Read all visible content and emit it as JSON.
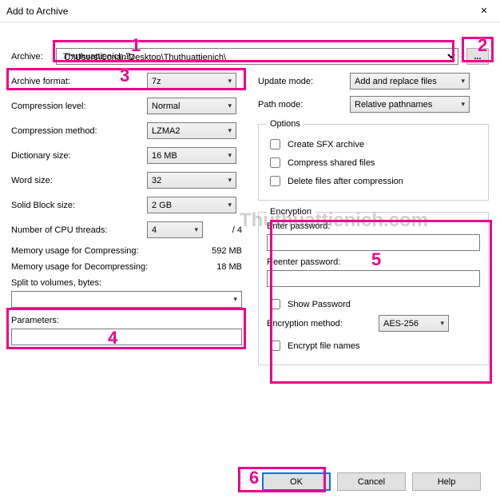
{
  "window": {
    "title": "Add to Archive",
    "close": "✕"
  },
  "archive": {
    "label": "Archive:",
    "path": "C:\\Users\\Conan\\Desktop\\Thuthuattienich\\",
    "filename": "Thuthuattienich.7z",
    "browse": "..."
  },
  "left": {
    "format_label": "Archive format:",
    "format": "7z",
    "level_label": "Compression level:",
    "level": "Normal",
    "method_label": "Compression method:",
    "method": "LZMA2",
    "dict_label": "Dictionary size:",
    "dict": "16 MB",
    "word_label": "Word size:",
    "word": "32",
    "block_label": "Solid Block size:",
    "block": "2 GB",
    "cpu_label": "Number of CPU threads:",
    "cpu": "4",
    "cpu_max": "/ 4",
    "mem_comp_label": "Memory usage for Compressing:",
    "mem_comp": "592 MB",
    "mem_decomp_label": "Memory usage for Decompressing:",
    "mem_decomp": "18 MB",
    "split_label": "Split to volumes, bytes:",
    "params_label": "Parameters:"
  },
  "right": {
    "update_label": "Update mode:",
    "update": "Add and replace files",
    "pathmode_label": "Path mode:",
    "pathmode": "Relative pathnames",
    "options_legend": "Options",
    "opt_sfx": "Create SFX archive",
    "opt_shared": "Compress shared files",
    "opt_delete": "Delete files after compression",
    "enc_legend": "Encryption",
    "enter_pw": "Enter password:",
    "reenter_pw": "Reenter password:",
    "show_pw": "Show Password",
    "enc_method_label": "Encryption method:",
    "enc_method": "AES-256",
    "enc_names": "Encrypt file names"
  },
  "buttons": {
    "ok": "OK",
    "cancel": "Cancel",
    "help": "Help"
  },
  "watermark": "Thuthuattienich.com",
  "annotations": {
    "n1": "1",
    "n2": "2",
    "n3": "3",
    "n4": "4",
    "n5": "5",
    "n6": "6"
  }
}
